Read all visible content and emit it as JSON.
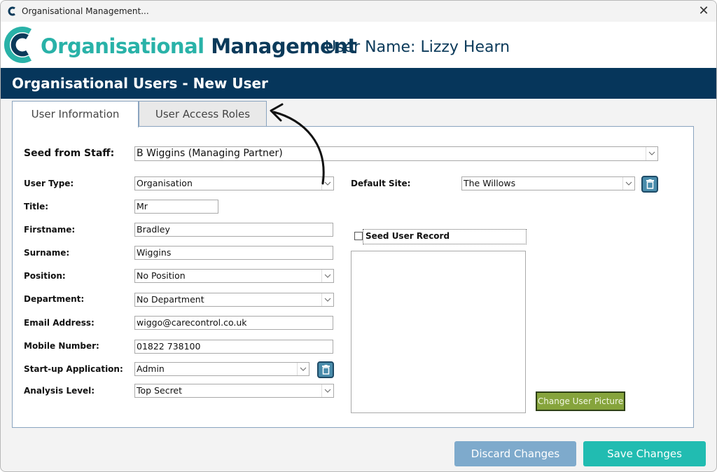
{
  "window": {
    "title": "Organisational Management...",
    "close_icon": "close-icon"
  },
  "header": {
    "brand_part1": "Organisational",
    "brand_part2": "Management",
    "user_name": "User Name: Lizzy Hearn",
    "colors": {
      "teal": "#29b2a8",
      "navy": "#0b3a5a"
    }
  },
  "banner": {
    "title": "Organisational Users - New User",
    "color": "#06365b"
  },
  "tabs": [
    {
      "label": "User Information",
      "active": true
    },
    {
      "label": "User Access Roles",
      "active": false
    }
  ],
  "form": {
    "seed_from_staff": {
      "label": "Seed from Staff:",
      "value": "B Wiggins (Managing Partner)"
    },
    "user_type": {
      "label": "User Type:",
      "value": "Organisation"
    },
    "title": {
      "label": "Title:",
      "value": "Mr"
    },
    "firstname": {
      "label": "Firstname:",
      "value": "Bradley"
    },
    "surname": {
      "label": "Surname:",
      "value": "Wiggins"
    },
    "position": {
      "label": "Position:",
      "value": "No Position"
    },
    "department": {
      "label": "Department:",
      "value": "No Department"
    },
    "email": {
      "label": "Email Address:",
      "value": "wiggo@carecontrol.co.uk"
    },
    "mobile": {
      "label": "Mobile Number:",
      "value": "01822 738100"
    },
    "startup_app": {
      "label": "Start-up Application:",
      "value": "Admin"
    },
    "analysis_level": {
      "label": "Analysis Level:",
      "value": "Top Secret"
    },
    "default_site": {
      "label": "Default Site:",
      "value": "The Willows"
    },
    "seed_user_record": {
      "label": "Seed User Record",
      "checked": false
    }
  },
  "buttons": {
    "change_picture": "Change User Picture",
    "discard": "Discard Changes",
    "save": "Save Changes",
    "colors": {
      "discard": "#7eaacc",
      "save": "#21bcb1",
      "change_picture": "#86a43c"
    }
  }
}
